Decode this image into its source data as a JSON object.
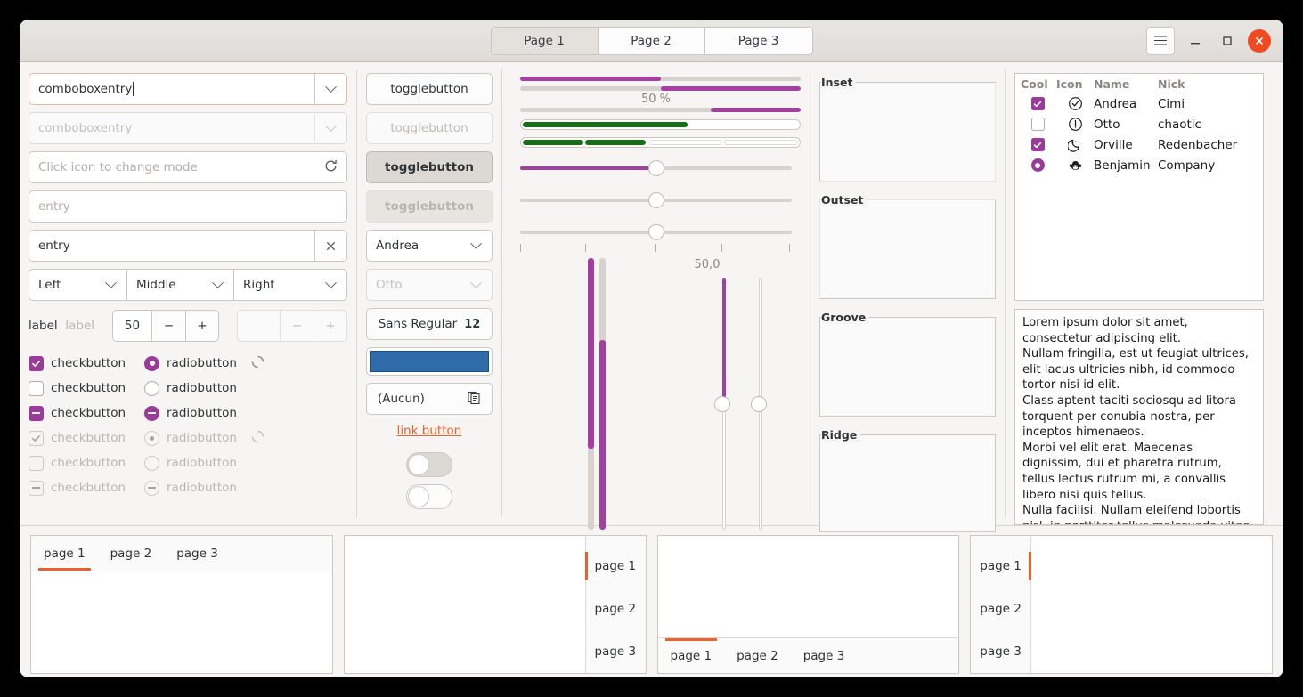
{
  "header": {
    "pages": [
      {
        "label": "Page 1",
        "active": true
      },
      {
        "label": "Page 2",
        "active": false
      },
      {
        "label": "Page 3",
        "active": false
      }
    ],
    "menu_icon": "hamburger-icon",
    "minimize_icon": "minimize-icon",
    "maximize_icon": "maximize-icon",
    "close_icon": "close-icon"
  },
  "column1": {
    "comboboxentry_active": "comboboxentry",
    "comboboxentry_disabled": "comboboxentry",
    "icon_entry_placeholder": "Click icon to change mode",
    "icon_entry_icon": "refresh-icon",
    "entry_placeholder": "entry",
    "entry_value": "entry",
    "entry_clear_icon": "clear-icon",
    "combos": [
      "Left",
      "Middle",
      "Right"
    ],
    "label_enabled": "label",
    "label_disabled": "label",
    "spin_value": "50",
    "spin_minus": "−",
    "spin_plus": "+",
    "spin_disabled_value": "",
    "checkbuttons": [
      {
        "label": "checkbutton",
        "state": "checked",
        "disabled": false,
        "spinner": true
      },
      {
        "label": "checkbutton",
        "state": "unchecked",
        "disabled": false,
        "spinner": false
      },
      {
        "label": "checkbutton",
        "state": "mixed",
        "disabled": false,
        "spinner": false
      },
      {
        "label": "checkbutton",
        "state": "checked",
        "disabled": true,
        "spinner": true
      },
      {
        "label": "checkbutton",
        "state": "unchecked",
        "disabled": true,
        "spinner": false
      },
      {
        "label": "checkbutton",
        "state": "mixed",
        "disabled": true,
        "spinner": false
      }
    ],
    "radiobuttons": [
      {
        "label": "radiobutton",
        "state": "checked",
        "disabled": false
      },
      {
        "label": "radiobutton",
        "state": "unchecked",
        "disabled": false
      },
      {
        "label": "radiobutton",
        "state": "mixed",
        "disabled": false
      },
      {
        "label": "radiobutton",
        "state": "checked",
        "disabled": true
      },
      {
        "label": "radiobutton",
        "state": "unchecked",
        "disabled": true
      },
      {
        "label": "radiobutton",
        "state": "mixed",
        "disabled": true
      }
    ]
  },
  "column2": {
    "toggles": [
      {
        "label": "togglebutton",
        "pressed": false,
        "disabled": false
      },
      {
        "label": "togglebutton",
        "pressed": false,
        "disabled": true
      },
      {
        "label": "togglebutton",
        "pressed": true,
        "disabled": false
      },
      {
        "label": "togglebutton",
        "pressed": true,
        "disabled": true
      }
    ],
    "combo_enabled": "Andrea",
    "combo_disabled": "Otto",
    "font_button": "Sans Regular",
    "font_size": "12",
    "color_button_value": "#2e6ba8",
    "file_button": "(Aucun)",
    "file_button_icon": "document-open-icon",
    "link_button": "link button",
    "switch_on_label": "",
    "switch_off_label": ""
  },
  "column3": {
    "progress_percent_label": "50 %",
    "scale_value_label": "50,0",
    "progressbars": [
      {
        "name": "progressbar-1",
        "fraction": 50,
        "inverted": false
      },
      {
        "name": "progressbar-2",
        "fraction": 50,
        "inverted": true
      },
      {
        "name": "progressbar-3",
        "fraction": 25,
        "inverted": true
      }
    ],
    "levelbars": [
      {
        "name": "levelbar-continuous",
        "fraction": 60,
        "discrete": false
      },
      {
        "name": "levelbar-discrete",
        "fraction": 40,
        "discrete": true,
        "blocks": 4
      }
    ],
    "scales": [
      {
        "name": "scale-filled",
        "value": 50,
        "filled": true,
        "marks": false
      },
      {
        "name": "scale-plain",
        "value": 50,
        "filled": false,
        "marks": false
      },
      {
        "name": "scale-marks",
        "value": 50,
        "filled": false,
        "marks": true
      }
    ],
    "vertical_levelbars": [
      {
        "name": "vlevelbar-1",
        "fraction": 70,
        "inverted": false
      },
      {
        "name": "vlevelbar-2",
        "fraction": 70,
        "inverted": true
      }
    ],
    "vertical_scales": [
      {
        "name": "vscale-filled",
        "value": 50,
        "filled": true
      },
      {
        "name": "vscale-plain",
        "value": 50,
        "filled": false
      }
    ],
    "accent_color": "#a33ea3",
    "level_color": "#157015"
  },
  "column4": {
    "frames": [
      {
        "label": "Inset",
        "style": "inset"
      },
      {
        "label": "Outset",
        "style": "outset"
      },
      {
        "label": "Groove",
        "style": "groove"
      },
      {
        "label": "Ridge",
        "style": "ridge"
      }
    ]
  },
  "column5": {
    "table": {
      "columns": [
        "Cool",
        "Icon",
        "Name",
        "Nick"
      ],
      "rows": [
        {
          "cool": "checked",
          "icon": "check-circle-icon",
          "name": "Andrea",
          "nick": "Cimi"
        },
        {
          "cool": "unchecked",
          "icon": "warning-circle-icon",
          "name": "Otto",
          "nick": "chaotic"
        },
        {
          "cool": "checked",
          "icon": "moon-face-icon",
          "name": "Orville",
          "nick": "Redenbacher"
        },
        {
          "cool": "radio",
          "icon": "monkey-face-icon",
          "name": "Benjamin",
          "nick": "Company"
        }
      ]
    },
    "textview": "Lorem ipsum dolor sit amet, consectetur adipiscing elit.\nNullam fringilla, est ut feugiat ultrices, elit lacus ultricies nibh, id commodo tortor nisi id elit.\nClass aptent taciti sociosqu ad litora torquent per conubia nostra, per inceptos himenaeos.\nMorbi vel elit erat. Maecenas dignissim, dui et pharetra rutrum, tellus lectus rutrum mi, a convallis libero nisi quis tellus.\nNulla facilisi. Nullam eleifend lobortis nisl, in porttitor tellus malesuada vitae."
  },
  "notebooks": [
    {
      "name": "notebook-top",
      "position": "top",
      "tabs": [
        "page 1",
        "page 2",
        "page 3"
      ],
      "active": 0
    },
    {
      "name": "notebook-right",
      "position": "right",
      "tabs": [
        "page 1",
        "page 2",
        "page 3"
      ],
      "active": 0
    },
    {
      "name": "notebook-bottom",
      "position": "bottom",
      "tabs": [
        "page 1",
        "page 2",
        "page 3"
      ],
      "active": 0
    },
    {
      "name": "notebook-left",
      "position": "left",
      "tabs": [
        "page 1",
        "page 2",
        "page 3"
      ],
      "active": 0
    }
  ]
}
